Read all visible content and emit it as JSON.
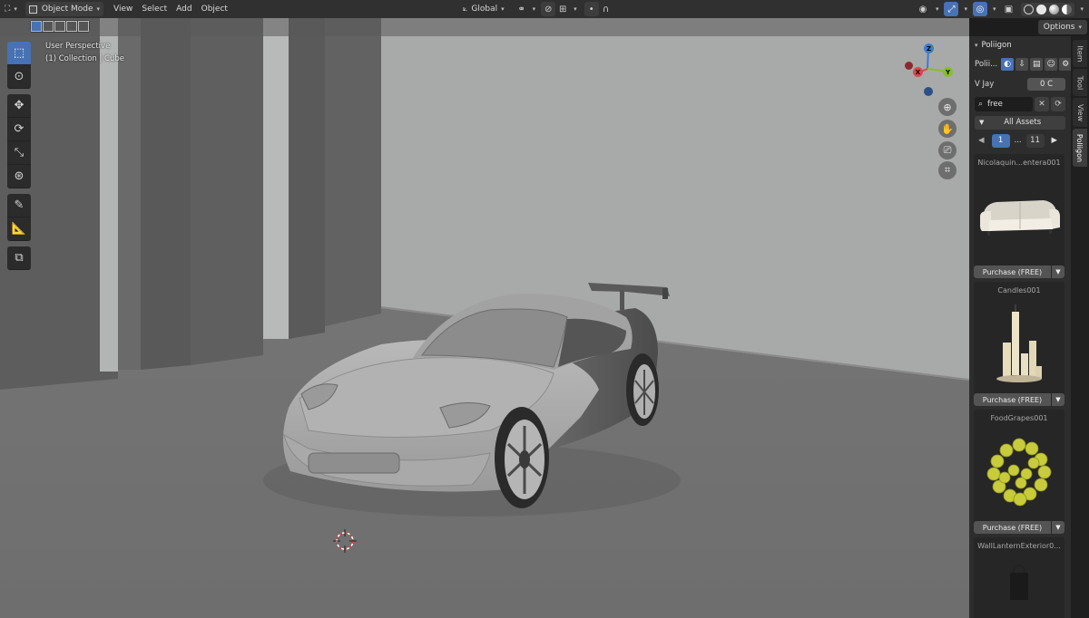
{
  "header": {
    "editor_icon": "view3d-editor-icon",
    "mode_label": "Object Mode",
    "menus": [
      "View",
      "Select",
      "Add",
      "Object"
    ],
    "transform_orientation": "Global",
    "options_label": "Options"
  },
  "viewport": {
    "view_name": "User Perspective",
    "collection_label": "(1) Collection | Cube",
    "gizmo_axes": [
      "Z",
      "X",
      "Y"
    ]
  },
  "tools": [
    "select-box-icon",
    "cursor-icon",
    "move-icon",
    "rotate-icon",
    "scale-icon",
    "transform-icon",
    "annotate-icon",
    "measure-icon",
    "add-cube-icon"
  ],
  "panel": {
    "title": "Poliigon",
    "short_label": "Polii...",
    "user_label": "V Jay",
    "credits_value": "0 C",
    "search_value": "free",
    "category_label": "All Assets",
    "pagination": {
      "current": "1",
      "ellipsis": "...",
      "last": "11"
    },
    "assets": [
      {
        "name": "Nicolaquin...entera001",
        "button": "Purchase (FREE)"
      },
      {
        "name": "Candles001",
        "button": "Purchase (FREE)"
      },
      {
        "name": "FoodGrapes001",
        "button": "Purchase (FREE)"
      },
      {
        "name": "WallLanternExterior0...",
        "button": ""
      }
    ]
  },
  "side_tabs": [
    "Item",
    "Tool",
    "View",
    "Poliigon"
  ],
  "colors": {
    "accent": "#4772b3",
    "axis_x": "#e0434c",
    "axis_y": "#88bd2a",
    "axis_z": "#3d7ad8"
  }
}
